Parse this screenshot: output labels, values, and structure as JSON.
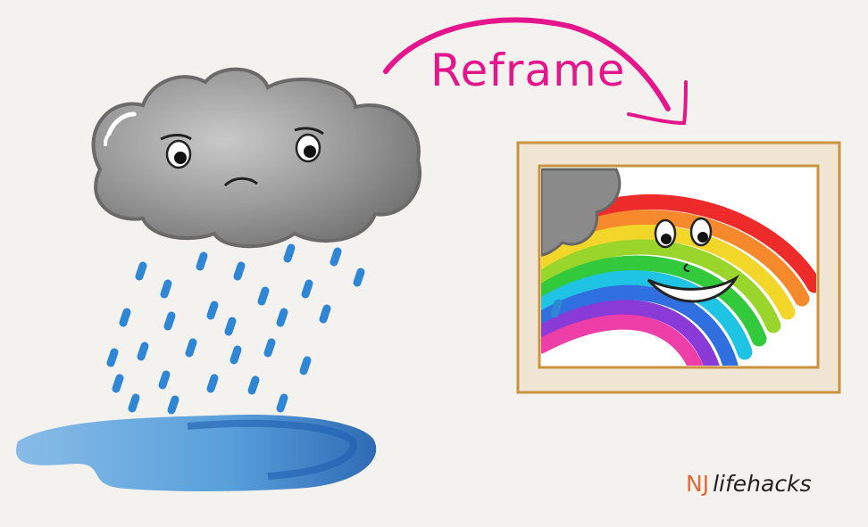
{
  "annotation": {
    "reframe_label": "Reframe"
  },
  "brand": {
    "prefix": "NJ",
    "suffix": "lifehacks"
  },
  "colors": {
    "background": "#f4f2ef",
    "arrow": "#e5168c",
    "rain": "#2f86d4",
    "puddle": "#3a8fd6",
    "cloud": "#8f8f8f",
    "frame": "#efe5d2",
    "frame_border": "#c9933f",
    "brand_prefix": "#e06a3a"
  },
  "illustration": {
    "left": "sad rain cloud over puddle",
    "right": "framed smiling rainbow"
  }
}
